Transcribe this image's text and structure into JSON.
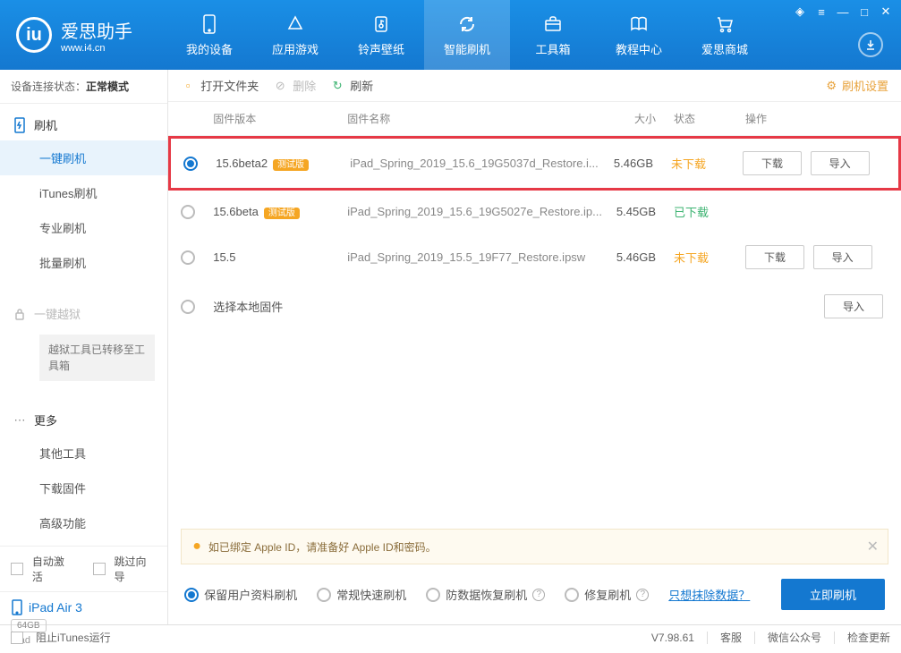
{
  "app": {
    "name": "爱思助手",
    "domain": "www.i4.cn"
  },
  "nav": [
    {
      "label": "我的设备"
    },
    {
      "label": "应用游戏"
    },
    {
      "label": "铃声壁纸"
    },
    {
      "label": "智能刷机"
    },
    {
      "label": "工具箱"
    },
    {
      "label": "教程中心"
    },
    {
      "label": "爱思商城"
    }
  ],
  "connection": {
    "label": "设备连接状态：",
    "value": "正常模式"
  },
  "sidebar": {
    "flash": {
      "header": "刷机",
      "items": [
        "一键刷机",
        "iTunes刷机",
        "专业刷机",
        "批量刷机"
      ]
    },
    "jailbreak": {
      "header": "一键越狱",
      "note": "越狱工具已转移至工具箱"
    },
    "more": {
      "header": "更多",
      "items": [
        "其他工具",
        "下载固件",
        "高级功能"
      ]
    },
    "auto_activate": "自动激活",
    "skip_guide": "跳过向导",
    "device": {
      "name": "iPad Air 3",
      "storage": "64GB",
      "type": "iPad"
    }
  },
  "toolbar": {
    "open_folder": "打开文件夹",
    "delete": "删除",
    "refresh": "刷新",
    "settings": "刷机设置"
  },
  "table": {
    "headers": {
      "version": "固件版本",
      "name": "固件名称",
      "size": "大小",
      "status": "状态",
      "action": "操作"
    },
    "rows": [
      {
        "selected": true,
        "highlight": true,
        "version": "15.6beta2",
        "badge": "测试版",
        "name": "iPad_Spring_2019_15.6_19G5037d_Restore.i...",
        "size": "5.46GB",
        "status": "未下载",
        "status_class": "undl",
        "download": true,
        "import": true
      },
      {
        "selected": false,
        "highlight": false,
        "version": "15.6beta",
        "badge": "测试版",
        "name": "iPad_Spring_2019_15.6_19G5027e_Restore.ip...",
        "size": "5.45GB",
        "status": "已下载",
        "status_class": "dl",
        "download": false,
        "import": false
      },
      {
        "selected": false,
        "highlight": false,
        "version": "15.5",
        "badge": "",
        "name": "iPad_Spring_2019_15.5_19F77_Restore.ipsw",
        "size": "5.46GB",
        "status": "未下载",
        "status_class": "undl",
        "download": true,
        "import": true
      }
    ],
    "local_firmware": "选择本地固件",
    "download_btn": "下载",
    "import_btn": "导入"
  },
  "notice": "如已绑定 Apple ID，请准备好 Apple ID和密码。",
  "options": {
    "keep_data": "保留用户资料刷机",
    "fast": "常规快速刷机",
    "recovery": "防数据恢复刷机",
    "repair": "修复刷机",
    "erase_link": "只想抹除数据？",
    "action": "立即刷机"
  },
  "footer": {
    "block_itunes": "阻止iTunes运行",
    "version": "V7.98.61",
    "service": "客服",
    "wechat": "微信公众号",
    "update": "检查更新"
  }
}
